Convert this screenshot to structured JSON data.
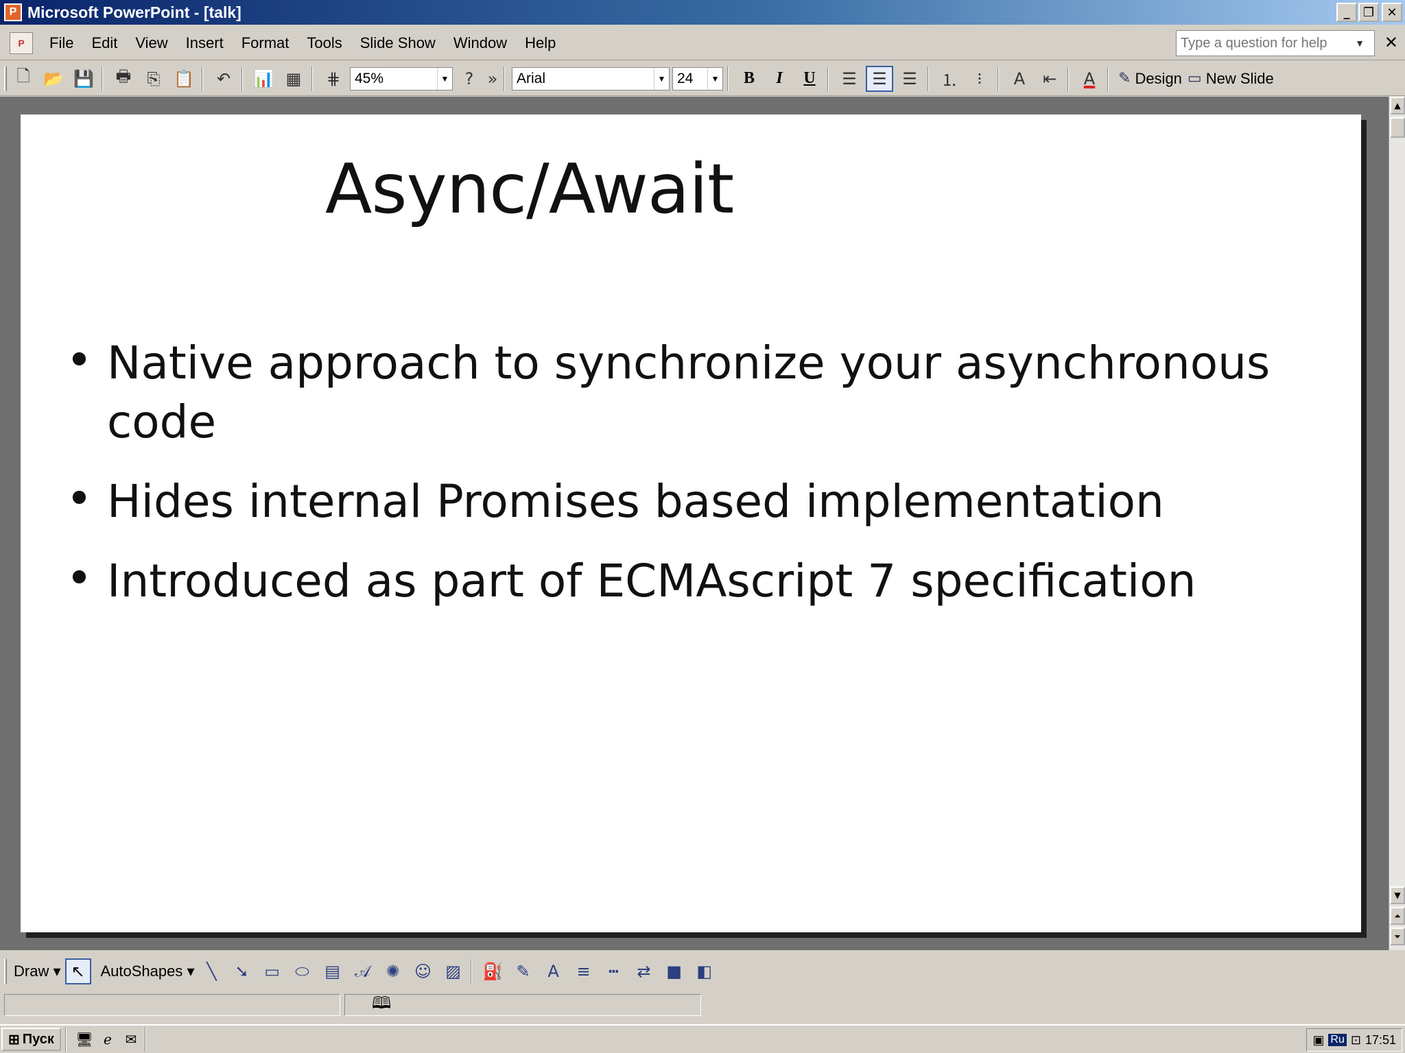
{
  "window": {
    "title": "Microsoft PowerPoint - [talk]",
    "buttons": [
      "_",
      "❐",
      "✕"
    ]
  },
  "menu": {
    "items": [
      "File",
      "Edit",
      "View",
      "Insert",
      "Format",
      "Tools",
      "Slide Show",
      "Window",
      "Help"
    ],
    "help_placeholder": "Type a question for help",
    "doc_close": "✕"
  },
  "toolbar": {
    "zoom": "45%",
    "font_name": "Arial",
    "font_size": "24",
    "bold": "B",
    "italic": "I",
    "underline": "U",
    "design_label": "Design",
    "new_slide_label": "New Slide",
    "overflow": "»"
  },
  "slide": {
    "title": "Async/Await",
    "bullets": [
      "Native approach to synchronize your asynchronous code",
      "Hides internal Promises based implementation",
      "Introduced as part of ECMAscript 7 specification"
    ]
  },
  "drawing_toolbar": {
    "draw_label": "Draw",
    "autoshapes_label": "AutoShapes"
  },
  "taskbar": {
    "start_label": "Пуск",
    "language": "Ru",
    "clock": "17:51"
  }
}
